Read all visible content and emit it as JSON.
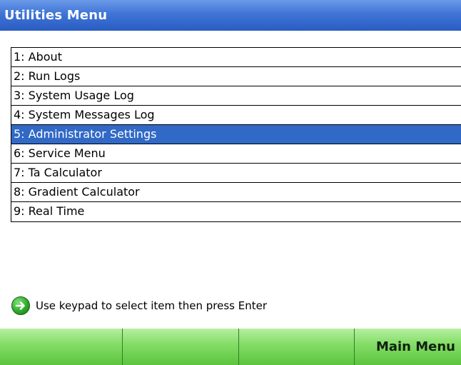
{
  "window": {
    "title": "Utilities Menu"
  },
  "menu": {
    "items": [
      {
        "label": "1: About",
        "selected": false
      },
      {
        "label": "2: Run Logs",
        "selected": false
      },
      {
        "label": "3: System Usage Log",
        "selected": false
      },
      {
        "label": "4: System Messages Log",
        "selected": false
      },
      {
        "label": "5: Administrator Settings",
        "selected": true
      },
      {
        "label": "6: Service Menu",
        "selected": false
      },
      {
        "label": "7: Ta Calculator",
        "selected": false
      },
      {
        "label": "8: Gradient Calculator",
        "selected": false
      },
      {
        "label": "9: Real Time",
        "selected": false
      }
    ]
  },
  "hint": {
    "icon": "arrow-right-circle-icon",
    "text": "Use keypad to select item then press Enter"
  },
  "softkeys": [
    {
      "label": ""
    },
    {
      "label": ""
    },
    {
      "label": ""
    },
    {
      "label": "Main Menu"
    }
  ],
  "colors": {
    "title_bar": "#3f74d6",
    "selection": "#3169c6",
    "softkey": "#86de6a",
    "hint_icon": "#2faa2a"
  }
}
